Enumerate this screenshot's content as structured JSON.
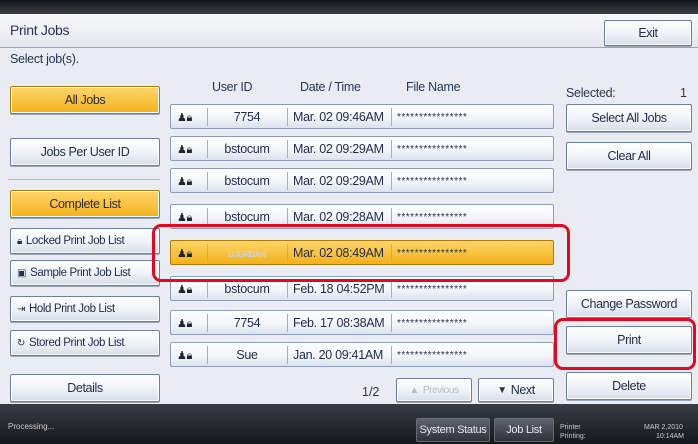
{
  "header": {
    "title": "Print Jobs",
    "exit_label": "Exit"
  },
  "select_label": "Select job(s).",
  "left_panel": {
    "all_jobs": "All Jobs",
    "jobs_per_user": "Jobs Per User ID",
    "complete_list": "Complete List",
    "locked_list": "Locked Print Job List",
    "sample_list": "Sample Print Job List",
    "hold_list": "Hold Print Job List",
    "stored_list": "Stored Print Job List",
    "details": "Details"
  },
  "table": {
    "headers": {
      "user_id": "User ID",
      "date_time": "Date / Time",
      "file_name": "File Name"
    },
    "rows": [
      {
        "user": "7754",
        "date": "Mar. 02 09:46AM",
        "file": "****************",
        "selected": false
      },
      {
        "user": "bstocum",
        "date": "Mar. 02 09:29AM",
        "file": "****************",
        "selected": false
      },
      {
        "user": "bstocum",
        "date": "Mar. 02 09:29AM",
        "file": "****************",
        "selected": false
      },
      {
        "user": "bstocum",
        "date": "Mar. 02 09:28AM",
        "file": "****************",
        "selected": false
      },
      {
        "user": "DJORDAN",
        "date": "Mar. 02 08:49AM",
        "file": "****************",
        "selected": true
      },
      {
        "user": "bstocum",
        "date": "Feb. 18 04:52PM",
        "file": "****************",
        "selected": false
      },
      {
        "user": "7754",
        "date": "Feb. 17 08:38AM",
        "file": "****************",
        "selected": false
      },
      {
        "user": "Sue",
        "date": "Jan. 20 09:41AM",
        "file": "****************",
        "selected": false
      }
    ],
    "row_icon": "person-lock-icon"
  },
  "pagination": {
    "indicator": "1/2",
    "previous": "Previous",
    "next": "Next"
  },
  "right_panel": {
    "selected_label": "Selected:",
    "selected_count": "1",
    "select_all": "Select All Jobs",
    "clear_all": "Clear All",
    "change_password": "Change Password",
    "print": "Print",
    "delete": "Delete"
  },
  "status_bar": {
    "status": "Processing...",
    "system_status": "System Status",
    "job_list": "Job List",
    "printer_line1": "Printer",
    "printer_line2": "Printing:",
    "date": "MAR 2,2010",
    "time": "10:14AM"
  },
  "colors": {
    "selected": "#f5b21c",
    "highlight": "#e3081f"
  }
}
